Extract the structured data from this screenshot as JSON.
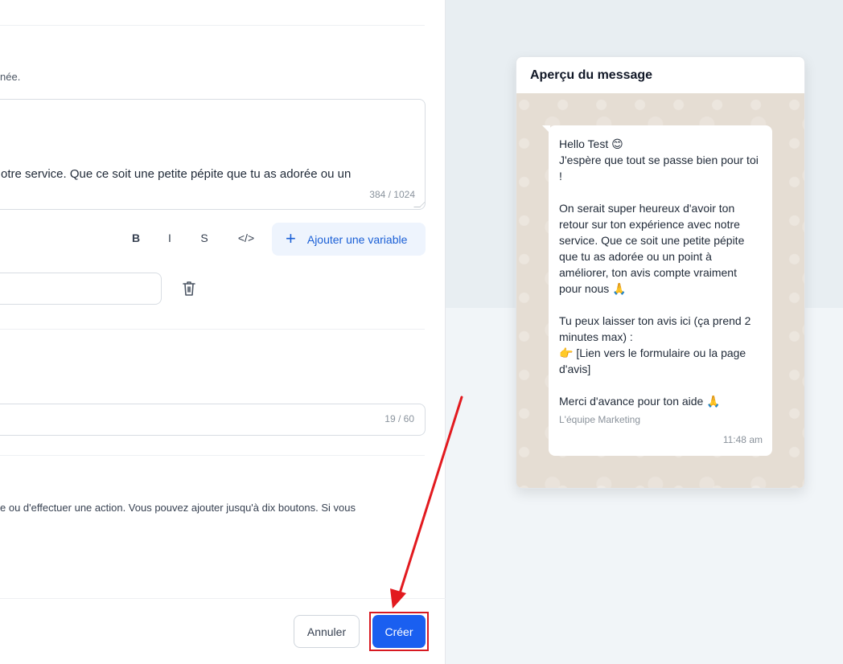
{
  "editor": {
    "helper_text": "née.",
    "body_visible_line": "otre service. Que ce soit une petite pépite que tu as adorée ou un",
    "body_counter": "384 / 1024",
    "format_buttons": {
      "bold": "B",
      "italic": "I",
      "strike": "S",
      "code": "</>"
    },
    "add_variable_label": "Ajouter une variable",
    "footer_counter": "19 / 60",
    "buttons_help_text": "e ou d'effectuer une action. Vous pouvez ajouter jusqu'à dix boutons. Si vous"
  },
  "actions": {
    "cancel_label": "Annuler",
    "create_label": "Créer"
  },
  "preview": {
    "title": "Aperçu du message",
    "message_body": "Hello Test 😊\nJ'espère que tout se passe bien pour toi !\n\nOn serait super heureux d'avoir ton retour sur ton expérience avec notre service. Que ce soit une petite pépite que tu as adorée ou un point à améliorer, ton avis compte vraiment pour nous 🙏\n\nTu peux laisser ton avis ici (ça prend 2 minutes max) :\n👉 [Lien vers le formulaire ou la page d'avis]\n\nMerci d'avance pour ton aide 🙏",
    "signature": "L'équipe Marketing",
    "time": "11:48 am"
  },
  "colors": {
    "primary": "#1a5ff0",
    "annotation": "#d71921",
    "chat_background": "#e5ddd3"
  }
}
